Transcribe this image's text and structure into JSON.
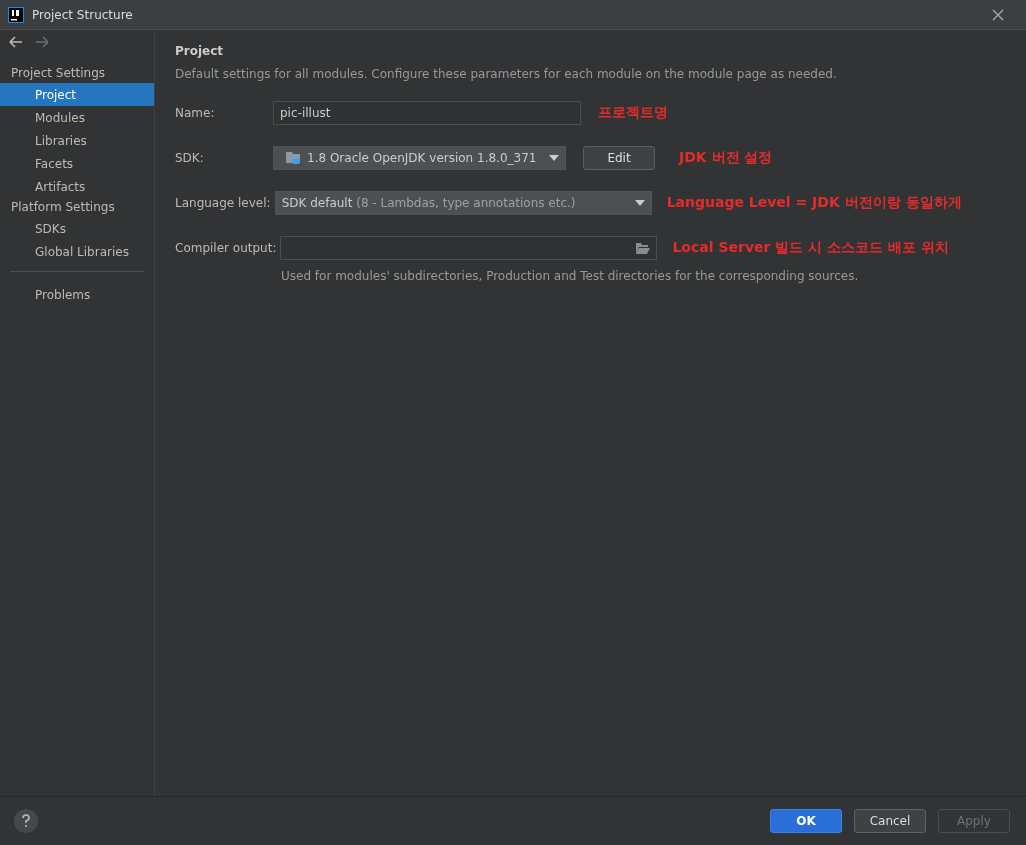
{
  "window": {
    "title": "Project Structure"
  },
  "nav": [
    {
      "kind": "back",
      "disabled": false
    },
    {
      "kind": "forward",
      "disabled": true
    }
  ],
  "sidebar": {
    "groups": [
      {
        "title": "Project Settings",
        "items": [
          {
            "label": "Project",
            "selected": true
          },
          {
            "label": "Modules",
            "selected": false
          },
          {
            "label": "Libraries",
            "selected": false
          },
          {
            "label": "Facets",
            "selected": false
          },
          {
            "label": "Artifacts",
            "selected": false
          }
        ]
      },
      {
        "title": "Platform Settings",
        "items": [
          {
            "label": "SDKs",
            "selected": false
          },
          {
            "label": "Global Libraries",
            "selected": false
          }
        ]
      }
    ],
    "bottom_items": [
      {
        "label": "Problems",
        "selected": false
      }
    ]
  },
  "main": {
    "heading": "Project",
    "description": "Default settings for all modules. Configure these parameters for each module on the module page as needed.",
    "fields": [
      {
        "kind": "text",
        "label": "Name:",
        "value": "pic-illust",
        "annotation": "프로젝트명"
      },
      {
        "kind": "sdk",
        "label": "SDK:",
        "value": "1.8 Oracle OpenJDK version 1.8.0_371",
        "button": "Edit",
        "annotation": "JDK 버전 설정"
      },
      {
        "kind": "select",
        "label": "Language level:",
        "value": "SDK default",
        "hint": "(8 - Lambdas, type annotations etc.)",
        "annotation": "Language Level = JDK 버전이랑 동일하게"
      },
      {
        "kind": "path",
        "label": "Compiler output:",
        "annotation": "Local Server 빌드 시 소스코드 배포 위치"
      }
    ],
    "note": "Used for modules' subdirectories, Production and Test directories for the corresponding sources."
  },
  "footer": {
    "buttons": [
      {
        "label": "OK",
        "kind": "primary",
        "disabled": false
      },
      {
        "label": "Cancel",
        "kind": "default",
        "disabled": false
      },
      {
        "label": "Apply",
        "kind": "default",
        "disabled": true
      }
    ]
  }
}
